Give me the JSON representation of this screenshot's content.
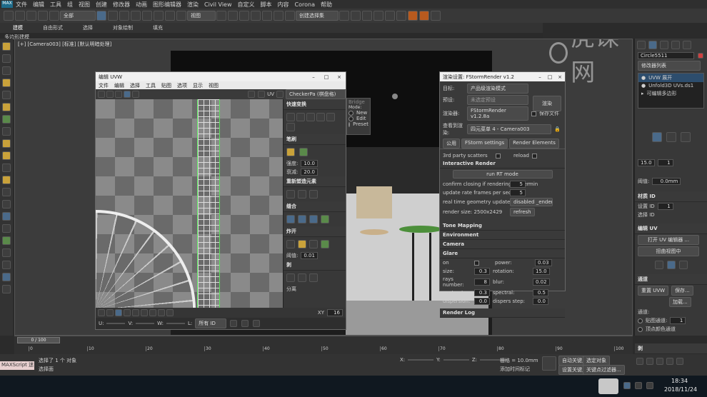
{
  "menubar": {
    "items": [
      "文件",
      "编辑",
      "工具",
      "组",
      "视图",
      "创建",
      "修改器",
      "动画",
      "图形编辑器",
      "渲染",
      "Civil View",
      "自定义",
      "脚本",
      "内容",
      "Corona",
      "帮助"
    ]
  },
  "toolbar": {
    "filter": "全部",
    "view": "视图",
    "selection_set": "创建选择集"
  },
  "ribbon_tabs": [
    "建模",
    "自由形式",
    "选择",
    "对象绘制",
    "填充"
  ],
  "ribbon_sub": "多边形建模",
  "viewport": {
    "label": "[+] [Camera003] [标准] [默认明暗处理]"
  },
  "uvw": {
    "title": "编辑 UVW",
    "menu": [
      "文件",
      "编辑",
      "选择",
      "工具",
      "贴图",
      "选项",
      "显示",
      "视图"
    ],
    "uv_label": "UV",
    "checker": "CheckerPa",
    "checker_opt": "(棋盘格)",
    "panels": {
      "quick": "快速变换",
      "brush": "笔刷",
      "strength_label": "强度:",
      "strength": "10.0",
      "falloff_label": "衰减:",
      "falloff": "20.0",
      "reshape": "重新塑造元素",
      "stitch": "缝合",
      "explode": "炸开",
      "weld_label": "阈值:",
      "weld": "0.01",
      "peel": "剥",
      "separate_label": "分离"
    },
    "status": {
      "u": "U:",
      "v": "V:",
      "w": "W:",
      "l": "L:",
      "all_ids": "所有 ID",
      "xy": "XY",
      "count": "16"
    }
  },
  "bridge": {
    "title": "Bridge",
    "mode_label": "Mode:",
    "modes": [
      "New",
      "Edit",
      "Preset"
    ]
  },
  "render": {
    "title": "渲染设置: FStormRender v1.2.8a",
    "target_label": "目标:",
    "target": "产品级渲染模式",
    "preset_label": "预设:",
    "preset": "未选定预设",
    "renderer_label": "渲染器:",
    "renderer": "FStormRender v1.2.8a",
    "save_file": "保存文件",
    "view_label": "查看到渲染:",
    "view": "四元菜单 4 - Camera003",
    "render_btn": "渲染",
    "tabs": [
      "公用",
      "FStorm settings",
      "Render Elements"
    ],
    "third_party": "3rd party scatters",
    "reload": "reload",
    "ir_section": "Interactive Render",
    "run_btn": "run RT mode",
    "confirm_label": "confirm closing if rendering longer",
    "confirm_val": "5",
    "confirm_unit": "min",
    "rate_label": "update rate frames per seconds",
    "rate_val": "5",
    "realtime_label": "real time geometry update",
    "realtime_val": "disabled _endering)",
    "size_label": "render size: 2500x2429",
    "refresh": "refresh",
    "sections": [
      "Tone Mapping",
      "Environment",
      "Camera",
      "Glare"
    ],
    "glare": {
      "rows": [
        [
          "on",
          "",
          "power:",
          "0.03"
        ],
        [
          "size:",
          "0.3",
          "rotation:",
          "15.0"
        ],
        [
          "rays number:",
          "8",
          "blur:",
          "0.02"
        ],
        [
          "contrast:",
          "0.3",
          "spectral:",
          "0.5"
        ],
        [
          "dispersion:",
          "0.0",
          "dispers step:",
          "0.0"
        ]
      ]
    },
    "log": "Render Log"
  },
  "right_panel": {
    "object_name": "Circle5511",
    "modifier_list": "修改器列表",
    "stack": [
      "UVW 展开",
      "Unfold3D UVs.ds1",
      "可编辑多边形"
    ],
    "val1": "15.0",
    "val2": "1",
    "angle_label": "阈值:",
    "angle": "0.0mm",
    "mat_section": "材质 ID",
    "set_id_label": "设置 ID",
    "set_id": "1",
    "select_id_label": "选择 ID",
    "edit_uv": "编辑 UV",
    "open_editor": "打开 UV 编辑器 ...",
    "tweak": "扭曲视图中",
    "channel_section": "通道",
    "reset_uvw": "重置 UVW",
    "save": "保存...",
    "load": "加载...",
    "channel_label": "通道:",
    "map_channel": "贴图通道:",
    "map_val": "1",
    "vertex_color": "顶点颜色通道",
    "peel_section": "剥"
  },
  "timeline": {
    "counter": "0 / 100",
    "ticks": [
      "0",
      "10",
      "20",
      "30",
      "40",
      "50",
      "60",
      "70",
      "80",
      "90",
      "100"
    ]
  },
  "status": {
    "maxscript": "MAXScript 迷",
    "selected": "选择了 1 个 对象",
    "hint": "选择面",
    "x_label": "X:",
    "y_label": "Y:",
    "z_label": "Z:",
    "grid": "栅格 = 10.0mm",
    "add_time": "添加时间标记",
    "auto_key": "自动关键点",
    "set_key": "设置关键点",
    "selected_obj": "选定对象",
    "filter": "关键点过滤器...",
    "time": "18:34",
    "date": "2018/11/24"
  },
  "watermark": "虎课网"
}
